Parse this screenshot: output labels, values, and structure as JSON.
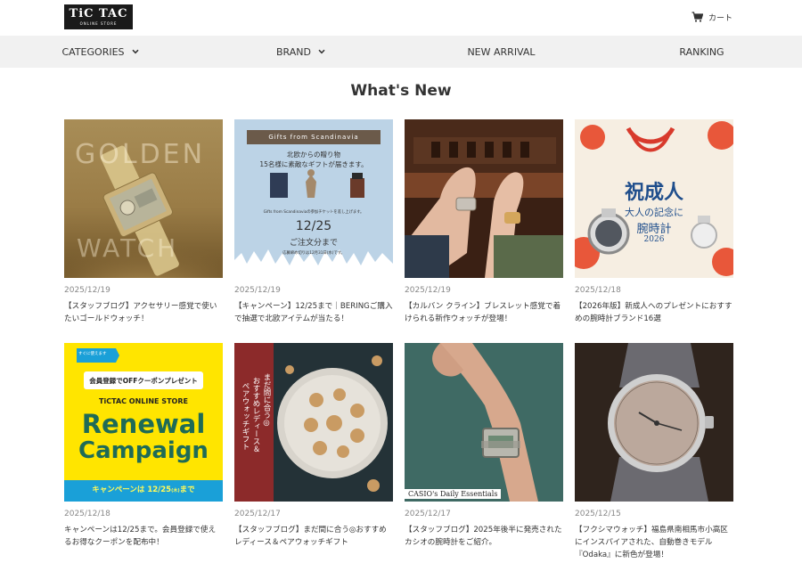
{
  "header": {
    "logo_main": "TiC TAC",
    "logo_sub": "ONLINE STORE",
    "cart_label": "カート",
    "cart_icon": "cart-icon"
  },
  "nav": [
    {
      "label": "CATEGORIES",
      "has_dropdown": true
    },
    {
      "label": "BRAND",
      "has_dropdown": true
    },
    {
      "label": "NEW ARRIVAL",
      "has_dropdown": false
    },
    {
      "label": "RANKING",
      "has_dropdown": false
    }
  ],
  "section_title": "What's New",
  "articles": [
    {
      "date": "2025/12/19",
      "title": "【スタッフブログ】アクセサリー感覚で使いたいゴールドウォッチ！",
      "image_text": {
        "top": "GOLDEN",
        "bottom": "WATCH"
      }
    },
    {
      "date": "2025/12/19",
      "title": "【キャンペーン】12/25まで｜BERINGご購入で抽選で北欧アイテムが当たる！",
      "image_text": {
        "banner": "Gifts from Scandinavia",
        "line1": "北欧からの贈り物",
        "line2": "15名様に素敵なギフトが届きます。",
        "small": "Gifts from Scandinaviaの参加チケットを差し上げます。",
        "date": "12/25",
        "until": "ご注文分まで",
        "note": "応募締め切りは12月31日(水)です。"
      }
    },
    {
      "date": "2025/12/19",
      "title": "【カルバン クライン】ブレスレット感覚で着けられる新作ウォッチが登場！",
      "image_text": {}
    },
    {
      "date": "2025/12/18",
      "title": "【2026年版】新成人へのプレゼントにおすすめの腕時計ブランド16選",
      "image_text": {
        "line1": "祝成人",
        "line2": "大人の記念に",
        "line3": "腕時計",
        "year": "2026"
      }
    },
    {
      "date": "2025/12/18",
      "title": "キャンペーンは12/25まで。会員登録で使えるお得なクーポンを配布中！",
      "image_text": {
        "tag": "すぐに使えます",
        "coupon": "会員登録でOFFクーポンプレゼント",
        "store": "TiCTAC ONLINE STORE",
        "line1": "Renewal",
        "line2": "Campaign",
        "footer": "キャンペーンは 12/25",
        "footer_small": "(木)",
        "footer_end": "まで"
      }
    },
    {
      "date": "2025/12/17",
      "title": "【スタッフブログ】まだ間に合う◎おすすめレディース＆ペアウォッチギフト",
      "image_text": {
        "col1": "まだ間に合う◎",
        "col2": "おすすめレディース＆",
        "col3": "ペアウォッチギフト"
      }
    },
    {
      "date": "2025/12/17",
      "title": "【スタッフブログ】2025年後半に発売されたカシオの腕時計をご紹介。",
      "image_text": {
        "caption": "CASIO's Daily Essentials"
      }
    },
    {
      "date": "2025/12/15",
      "title": "【フクシマウォッチ】福島県南相馬市小高区にインスパイアされた、自動巻きモデル『Odaka』に新色が登場！",
      "image_text": {}
    }
  ],
  "colors": {
    "nav_bg": "#f1f1f1",
    "logo_bg": "#1a1a1a",
    "date": "#888888",
    "text": "#333333",
    "campaign_yellow": "#ffe500",
    "campaign_blue": "#1aa0d8"
  }
}
